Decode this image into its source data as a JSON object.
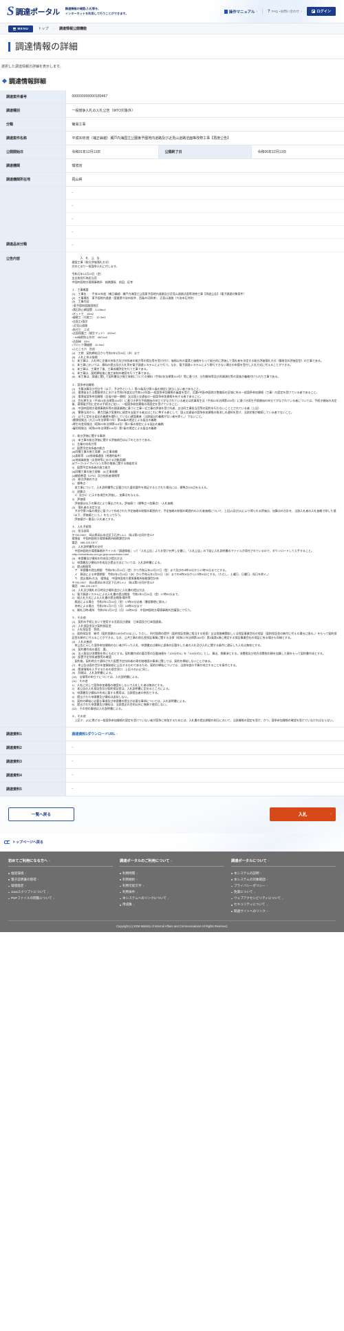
{
  "header": {
    "brand_mark": "S",
    "brand_name": "調達ポータル",
    "tagline_line1": "調達情報の確認・入札等を、",
    "tagline_line2": "インターネットを利用して行うことができます。",
    "manual_label": "操作マニュアル",
    "faq_label": "FAQ",
    "faq_sub": "・お問い合わせ",
    "login_label": "ログイン",
    "chevron": "›"
  },
  "breadcrumb": {
    "menu_label": "MENU",
    "items": [
      "トップ",
      "調達情報公開機能"
    ],
    "separator": "›"
  },
  "page": {
    "title": "調達情報の詳細",
    "description": "選択した調達情報の詳細を表示します。",
    "section_title": "調達情報詳細"
  },
  "detail": {
    "rows": [
      {
        "label": "調達案件番号",
        "value": "000000000000189467"
      },
      {
        "label": "調達種別",
        "value": "一般競争入札の入札公告（WTO対象外）"
      },
      {
        "label": "分類",
        "value": "簡易工事"
      },
      {
        "label": "調達案件名称",
        "value": "平成30年度（補正繰越）瀬戸内海国立公園東予園地内道路及び近見山道路法面等改修工事【再度公告】"
      }
    ],
    "publish_start_label": "公開開始日",
    "publish_start_value": "令和01年12月13日",
    "publish_end_label": "公開終了日",
    "publish_end_value": "令和06年12月13日",
    "org_label": "調達機関",
    "org_value": "環境省",
    "org_loc_label": "調達機関所在地",
    "org_loc_value": "岡山県",
    "category_label": "調達品目分類",
    "category_values": [
      "-",
      "-",
      "-",
      "-",
      "-"
    ],
    "announcement_label": "公告内容",
    "attachments": [
      {
        "label": "調達資料1",
        "link_text": "調達資料1ダウンロードURL",
        "has_link": true,
        "value": ""
      },
      {
        "label": "調達資料2",
        "link_text": "",
        "has_link": false,
        "value": "-"
      },
      {
        "label": "調達資料3",
        "link_text": "",
        "has_link": false,
        "value": "-"
      },
      {
        "label": "調達資料4",
        "link_text": "",
        "has_link": false,
        "value": "-"
      },
      {
        "label": "調達資料5",
        "link_text": "",
        "has_link": false,
        "value": "-"
      }
    ],
    "announcement_text": "　　　入　札　公　告\n建設工事（総合評価落札方式）\n次のとおり一般競争入札に付します。\n\n令和元年12月13日（金）\n支出負担行為担当官\n中国四国地方環境事務所　総務課長　前田　征孝\n\n１．工事概要\n(1)　工事名　　平成30年度（補正繰越）瀬戸内海国立公園東予園地内道路及び近見山道路法面等改修工事【再度公告】（電子調達対象案件）\n(2)　工事場所　東予園地内道路（愛媛県今治市桜井、西条市河原津）、近見山道路（今治市石井町）\n(3)　工事内容\n○東予園地園路園地区\n・落石防止網設置　3,108m2\n・ネット工　16m2\n・擁壁工（化粧工）　10.3m3\n・法面工・張芝\n○近見山道路\n・吹付工　二式\n・法面保護工（植生マット）　452m2\n・A4緑肥防止吹付　4521m2\n・法面緑　42m\n・ブロック積擁壁　10.9m2\n・ふところ穴　別途\n(4)　工期　契約締結日から令和2年3月26日（木）まで\n(5)　入札に係る指標\n1)　本工事は、入札時に企業の技術力及び技術者の能力等の提出等を受け付け、価格以外の要素と価格をもって総合的に評価して落札者を決定する総合評価落札方式（簡易型の評価型型）の工事である。\n2)　本工事においては、資料の提出及び入札等を電子調達システムにより行う。なお、電子調達システムにより移行できない場合の申請を受付し入札方式に代えることができる。\n3)　本工事は、工事完了後、工事成績評定を行う工事である。\n4)　本工事は、契約締結後に施工体制の確認を行う工事である。\n(6)　本工事は、調達に関して契約書及び施工体制についての資料（令和2年法律第114号）等に基づき、分別解体等及び再資源化等の実施が義務付けられた工事である。\n\n２．競争参加資格\n(1)　予算決算及び会計令（以下、予決令という。）第70条及び第71条の規定に該当しない者であること。\n(2)　環境省または関東地方における令和2年度又は令和1・2年度・一般競争参加資格の審査を受け、近畿・中国・四国地方整備局の区域に係る一般競争参加資格（工事）の認定を受けている者であること。\n(3)　環境省競争参加資格（全省庁統一資格）又は国土交通省の一般競争参加資格を有する者であること。\n(4)　会社更生法（平成14年法律第154号）に基づき更生手続開始の申立てがなされている者又は民事再生法（平成11年法律第225号）に基づき再生手続開始の申立てがなされている者については、手続き開始の決定後、環境省が別に定める手続きに従い、一般競争参加資格の再認定を受けていること。\n(5)　中国四国地方環境事務所等の調達業務に基づく工事一式工事の評価を受け外者、又は同工事担当官等の契約を行わないこととされている者（上記）\n(6)　警察当局から、暴力団員が実質的に経営を支配する者又はこれに準ずる者として、国土交通省の競争参加資格の取消しの通知を受け、当該状態が継続している者でないこと。\n(7)　以下に定める届出の義務を履行していない建設業者（当該届出の義務がない者を除く。）でないこと。\n・健康保険法（大正11年法律第70号）第48条の規定による届出の義務\n・厚生年金保険法（昭和29年法律第115号）第27条の規定による届出の義務\n・雇用保険法（昭和49年法律第116号）第7条の規定による届出の義務\n\n３．総合評価に関する事項\n(1)　本工事の総合評価に関する評価項目は以下のとおりである。\n1)　企業の技術力等\n2)　配置予定技術者の能力\n(a)同種工事の施工実績　(b)工事成績\n(c)表彰等　(d)地域精通度（地理的条件）\n(e)地域貢献度（災害時等における活動実績）\n(f)ワーク・ライフ・バランス等の推進に関する取組状況\n3)　配置予定技術者の施工能力\n(a)同種工事の施工経験　(b)工事成績\n(c)継続教育（CPD）及び技術者資格等\n(2)　総合評価の方法\n1)　標準点\n　本工事について、入札説明書等に記載された要求要件を満足するとされた場合には、標準点100点を与える。\n2)　加算点\n　1）及び2）に示す各項目を評価し、加算点を与える。\n3)　評価値\n　評価値は以下の算式により算出される。評価値＝（標準点＋加算点）÷入札価格\n(3)　落札者の決定方法\n　予決令第79条の規定に基づいて作成された予定価格の制限の範囲内で、予定価格の制限の範囲内の入札者価格について、上記(2)及び(3)により得られる評価点、加算点の合計を、当該入札者の入札価格で除した値（以下、評価値という。）をもって行う。\n　評価値が一番高い入札者とする。\n\n４．入札手続等\n(1)　担当部局\n〒700-0907　岡山県岡山市北区下石井1-4-1　岡山第2合同庁舎11F\n環境省　中国四国地方環境事務所総務課会計係\n電話　086-223-1577\n(2)　入札説明書等の交付\n　中国四国地方環境事務所サイトの「調達情報」って「入札公告」よりお受けを押し文書に、「入札公告」の下段に入札説明書のファイルが添付されているので、ダウンロードして入手すること。\n・http://chushikoku.env.go.jp/procure/index.html\n(3)　申請書及び資料の作成及び提出方法\n1)　申請書及び資料の作成及び提出方法については、入札説明書による。\n2)　提出期限等\n　ア　申請書の提出期限　令和2年1月10日（金）から令和元年12月27日（金）まで及びの9時00分から17時00分までとする。\n　イ　郵送による申請期限　令和2年1月15日（水）から令和元年1月21日（水）までの9時00分から17時00分とする。（ただし、土曜日、日曜日、祝日を除く。）\n　ウ　提出場所・方法　環境省　中国四国地方環境事務所総務課会計係\n〒700-0907　岡山県岡山市北区下石井1-4-1　岡山第2合同庁舎11F\n電話　086-223-1577\n(4)　入札及び開札の日時及び場所並びに入札書の提出方法\n1)　電子調達システムによる入札書の提出期限　令和2年1月24日（金）17時00分まで。\n2)　紙入札方式による入札書の提出期限・場所等\n　郵送による場合　令和2年1月24日（金）17時00分必着（書留郵便に限る。）\n　持参による場合　令和2年1月27日（月）10時00分まで\n3)　開札日時・場所　令和2年1月27日（月）10時30分　中国四国地方環境事務所会議室にて行う。\n\n５．その他\n(1)　契約の手続において使用する言語及び通貨　日本語及び日本国通貨。\n(2)　入札保証金及び契約保証金\n1)　入札保証金　免除。\n2)　契約保証金　納付（契約金額の100分の10以上）。ただし、利付国債の提供（契約保証金額に相当する担保）又は金融機関若しくは保証事業会社の保証（契約保証金の納付に代える場合に限る。）をもって契約保証金の納付に代えることができる。なお、公共工事の前払金保証事業に関する法律（昭和27年法律第184号）第2条第4項に規定する保証事業会社の保証に係る場合も同様とする。\n(3)　入札の無効\n　本公告に示した競争参加資格のない者が行った入札、申請書又は資料に虚偽の記載をした者の入札及び入札に関する条件に違反した入札は無効とする。\n(4)　契約書作成の要否　要。\n(5)　法人税及び消費税を除くものとする。契約書作成の要否等の記載価格を「100分の4」を「100分の2」とし、算出、換算済とする。消費税及び地方消費税の額を加算した額をもって契約書作成とする。\n(6)　配置予定技術者数等の確認\n　契約後、契約時点で通知された配置予定技術者の専任制確認の事項に関しては、契約を締結しないことがある。\n(7)　本公告は国の会計年度開始前に公告するものであるため、契約の締結については、当該年度の予算が成立することを条件とする。\n(8)　関連情報を入手するための照会窓口　上記４の(1)に同じ。\n(9)　詳細は、入札説明書による。\n(10)　苦情等の申立てについては、入札説明書による。\n(11)　その他\n1)　入札に対して競争参加資格の確認をしないで入札した者は無効とする。\n2)　本公告の入札保証金及び契約保証金は、入札説明書に定めるところによる。\n3)　申請書及び資料の作成に要する費用は、当該提出者の負担とする。\n4)　提出された申請書及び資料は返却しない。\n5)　契約の締結に必要な事項及び申請書の提出が必要な事項については、入札説明書による。\n6)　提出された申請書及び資料は、当該提出の目的以外に無断で使用しない。\n(12)　その他の事項は入札説明書による。\n\n６．その他\n　上記２．(2)に掲げる一般競争参加資格の認定を受けていない者が競争に参加するためには、入札書の提出期限の前日において、当該資格の認定を受け、かつ、競争参加資格の確認を受けていなければならない。"
  },
  "actions": {
    "back_label": "一覧へ戻る",
    "bid_label": "入札",
    "bid_chevron": "›"
  },
  "to_top": {
    "label": "トップページへ戻る"
  },
  "footer": {
    "columns": [
      {
        "heading": "初めてご利用になる方へ",
        "links": [
          "推奨環境",
          "電子証明書の取得",
          "環境設定",
          "Javaスクリプトについて",
          "PDFファイルの閲覧について"
        ]
      },
      {
        "heading": "調達ポータルのご利用について",
        "links": [
          "利用時間",
          "利用規約",
          "利用可能文字",
          "利用条件",
          "本システムへのリンクについて",
          "用語集"
        ]
      },
      {
        "heading": "調達ポータルについて",
        "links": [
          "本システムの説明",
          "本システムの対象範囲",
          "プライバシーポリシー",
          "免責について",
          "ウェブアクセシビリティについて",
          "セキュリティについて",
          "関連サイトへのリンク"
        ]
      }
    ],
    "chevron": "›",
    "copyright": "Copyright (c) 2018 Ministry of Internal Affairs and Communications All Rights Reserved."
  },
  "colors": {
    "brand_blue": "#1b3c8c",
    "link_blue": "#1d63c4",
    "accent_orange": "#d8491a",
    "table_header_bg": "#e8eef7",
    "footer_bg": "#6e6e6e"
  }
}
